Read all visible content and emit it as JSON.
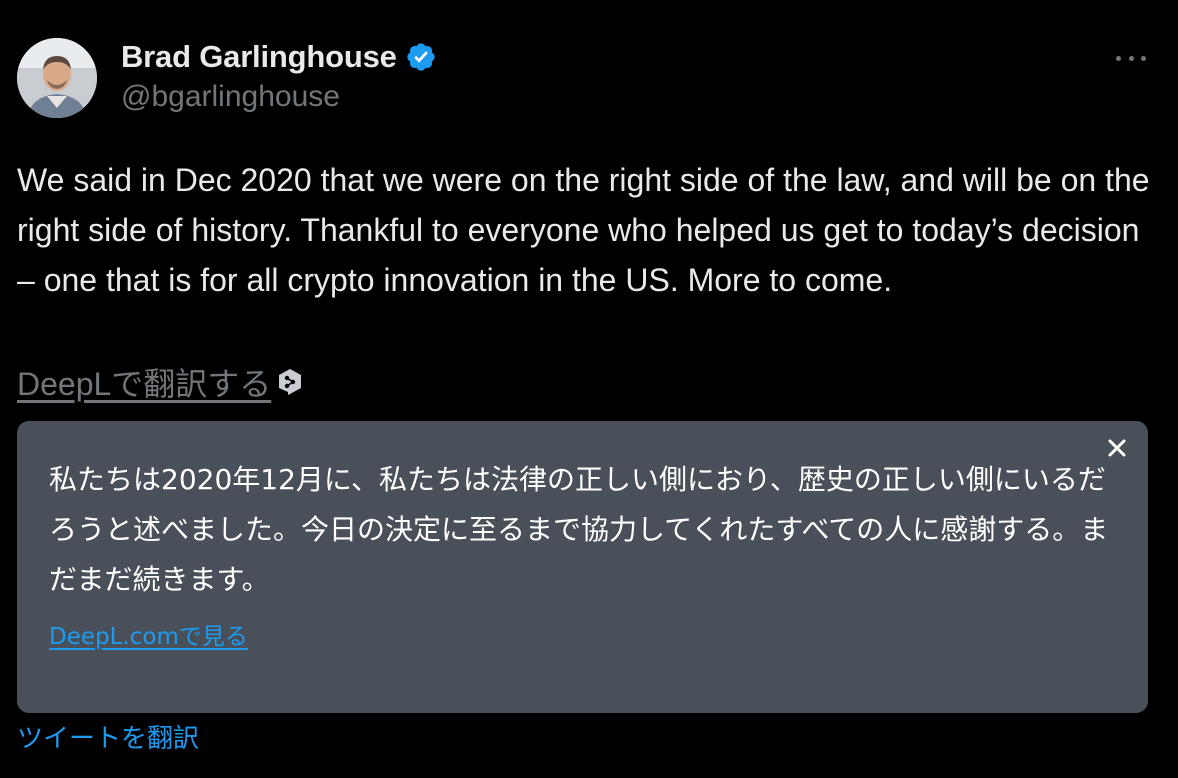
{
  "author": {
    "name": "Brad Garlinghouse",
    "handle": "@bgarlinghouse",
    "verified": true
  },
  "tweet": {
    "text": "We said in Dec 2020 that we were on the right side of the law, and will be on the right side of history. Thankful to everyone who helped us get to today’s decision – one that is for all crypto innovation in the US. More to come."
  },
  "deepl": {
    "translate_link": "DeepLで翻訳する",
    "translated_text": "私たちは2020年12月に、私たちは法律の正しい側におり、歴史の正しい側にいるだろうと述べました。今日の決定に至るまで協力してくれたすべての人に感謝する。まだまだ続きます。",
    "view_link": "DeepL.comで見る"
  },
  "translate_tweet_label": "ツイートを翻訳",
  "icons": {
    "more": "more-horizontal-icon",
    "verified": "verified-badge-icon",
    "deepl": "deepl-logo-icon",
    "close": "close-icon"
  },
  "colors": {
    "background": "#000000",
    "text_primary": "#e7e9ea",
    "text_secondary": "#71767b",
    "accent_blue": "#1d9bf0",
    "card_background": "#4a5059"
  }
}
